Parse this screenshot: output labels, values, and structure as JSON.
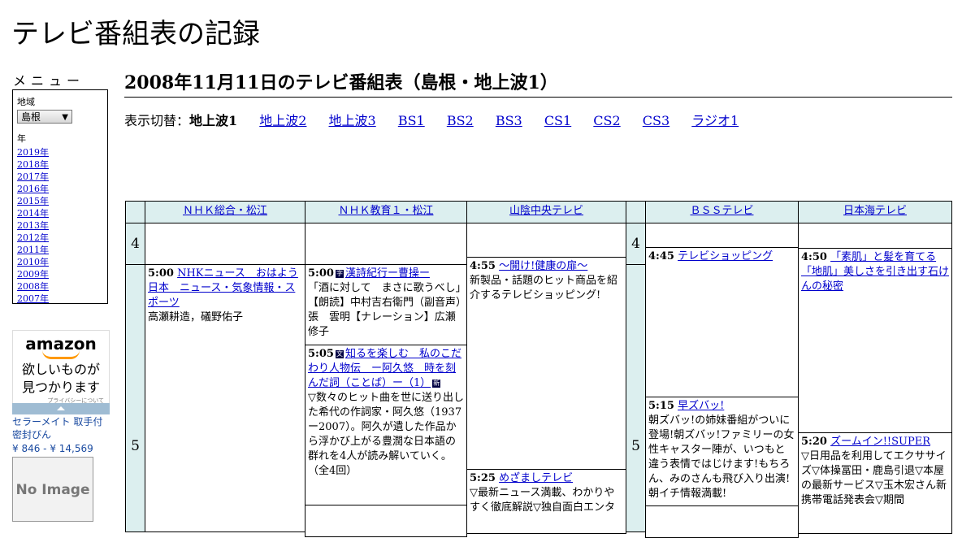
{
  "site": {
    "title": "テレビ番組表の記録"
  },
  "menu": {
    "title": "メニュー",
    "region_label": "地域",
    "region_value": "島根",
    "year_label": "年",
    "years": [
      "2019年",
      "2018年",
      "2017年",
      "2016年",
      "2015年",
      "2014年",
      "2013年",
      "2012年",
      "2011年",
      "2010年",
      "2009年",
      "2008年",
      "2007年"
    ]
  },
  "ad": {
    "logo": "amazon",
    "copy_line1": "欲しいものが",
    "copy_line2": "見つかります",
    "privacy": "プライバシーについて",
    "product_line1": "セラーメイト 取手付",
    "product_line2": "密封びん",
    "price": "¥ 846 - ¥ 14,569",
    "no_image": "No Image"
  },
  "page": {
    "title": "2008年11月11日のテレビ番組表（島根・地上波1）"
  },
  "switcher": {
    "label": "表示切替：",
    "current": "地上波1",
    "links": [
      "地上波2",
      "地上波3",
      "BS1",
      "BS2",
      "BS3",
      "CS1",
      "CS2",
      "CS3",
      "ラジオ1"
    ]
  },
  "grid": {
    "channels": [
      "ＮＨＫ総合・松江",
      "ＮＨＫ教育１・松江",
      "山陰中央テレビ",
      "ＢＳＳテレビ",
      "日本海テレビ"
    ],
    "hours": [
      "4",
      "5"
    ],
    "programs": {
      "nhk_sogo_1": {
        "time": "5:00",
        "title": "NHKニュース　おはよう日本　ニュース・気象情報・スポーツ",
        "desc": "高瀬耕造，礒野佑子"
      },
      "nhk_edu_1": {
        "time": "5:00",
        "title": "漢詩紀行ー曹操ー",
        "desc": "「酒に対して　まさに歌うべし」　【朗読】中村吉右衛門（副音声）張　雲明【ナレーション】広瀬修子"
      },
      "nhk_edu_2": {
        "time": "5:05",
        "title": "知るを楽しむ　私のこだわり人物伝　ー阿久悠　時を刻んだ詞（ことば）ー（1）",
        "desc": "▽数々のヒット曲を世に送り出した希代の作詞家・阿久悠（1937ー2007）。阿久が遺した作品から浮かび上がる豊潤な日本語の群れを4人が読み解いていく。（全4回）"
      },
      "sanin_1": {
        "time": "4:55",
        "title": "～開け!健康の扉～",
        "desc": "新製品・話題のヒット商品を紹介するテレビショッピング!"
      },
      "sanin_2": {
        "time": "5:25",
        "title": "めざましテレビ",
        "desc": "▽最新ニュース満載、わかりやすく徹底解説▽独自面白エンタ"
      },
      "bss_1": {
        "time": "4:45",
        "title": "テレビショッピング",
        "desc": ""
      },
      "bss_2": {
        "time": "5:15",
        "title": "早ズバッ!",
        "desc": "朝ズバッ!の姉妹番組がついに登場!朝ズバッ!ファミリーの女性キャスター陣が、いつもと違う表情ではじけます!もちろん、みのさんも飛び入り出演!朝イチ情報満載!"
      },
      "nihonkai_1": {
        "time": "4:50",
        "title": "「素肌」と髪を育てる「地肌」美しさを引き出す石けんの秘密",
        "desc": ""
      },
      "nihonkai_2": {
        "time": "5:20",
        "title": "ズームイン!!SUPER",
        "desc": "▽日用品を利用してエクササイズ▽体操冨田・鹿島引退▽本屋の最新サービス▽玉木宏さん新携帯電話発表会▽期間"
      }
    }
  }
}
